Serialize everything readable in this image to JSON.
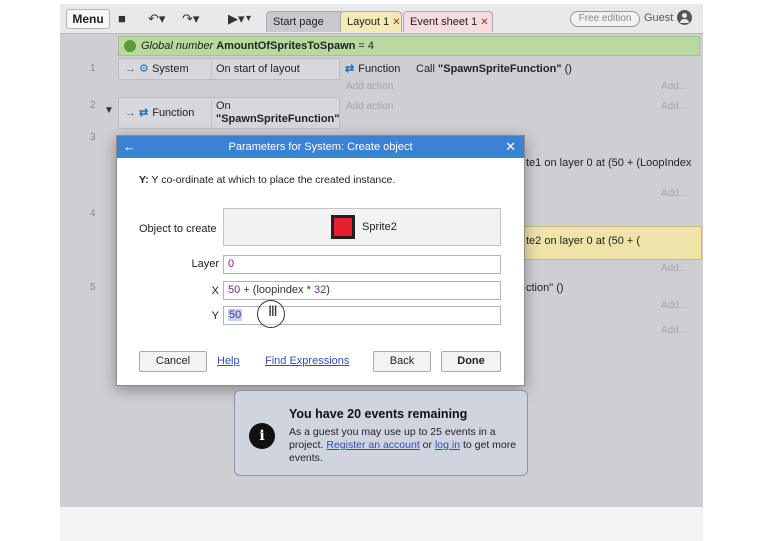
{
  "toolbar": {
    "menu_label": "Menu",
    "save_icon": "save-icon",
    "undo_icon": "undo-icon",
    "redo_icon": "redo-icon",
    "play_icon": "play-icon",
    "tabs": [
      {
        "label": "Start page",
        "closable": false
      },
      {
        "label": "Layout 1",
        "closable": true
      },
      {
        "label": "Event sheet 1",
        "closable": true
      }
    ],
    "edition_badge": "Free edition",
    "user_label": "Guest"
  },
  "sheet": {
    "global": {
      "prefix": "Global number",
      "name": "AmountOfSpritesToSpawn",
      "value": "= 4"
    },
    "events": [
      {
        "number": "1",
        "object": "System",
        "condition": "On start of layout",
        "action_object": "Function",
        "action": "Call \"SpawnSpriteFunction\" ()"
      },
      {
        "number": "2",
        "object": "Function",
        "condition_line1": "On",
        "condition_line2": "\"SpawnSpriteFunction\""
      },
      {
        "number": "3",
        "action_tail": "te1 on layer 0 at (50 + (LoopIndex"
      },
      {
        "number": "4",
        "action_tail": "te2 on layer 0 at (50 + ("
      },
      {
        "number": "5",
        "action_tail": "ction\" ()"
      }
    ],
    "add_action": "Add action",
    "add": "Add..."
  },
  "dialog": {
    "title": "Parameters for System: Create object",
    "desc_param": "Y:",
    "desc_text": "Y co-ordinate at which to place the created instance.",
    "object_label": "Object to create",
    "object_value": "Sprite2",
    "layer_label": "Layer",
    "layer_value": "0",
    "x_label": "X",
    "x_num": "50",
    "x_rest_op": " + ",
    "x_rest": "(loopindex",
    "x_op2": " * ",
    "x_num2": "32",
    "x_close": ")",
    "y_label": "Y",
    "y_value": "50",
    "cancel_label": "Cancel",
    "help_label": "Help",
    "find_label": "Find Expressions",
    "back_label": "Back",
    "done_label": "Done"
  },
  "info": {
    "title": "You have 20 events remaining",
    "body_1": "As a guest you may use up to 25 events in a project.",
    "register_link": "Register an account",
    "body_or": "or",
    "login_link": "log in",
    "body_2": "to get more events."
  },
  "colors": {
    "dialog_title_bar": "#3b82d6",
    "global_row": "#b9d9a0",
    "sprite_swatch": "#e8202e",
    "link": "#2c4fbf"
  }
}
